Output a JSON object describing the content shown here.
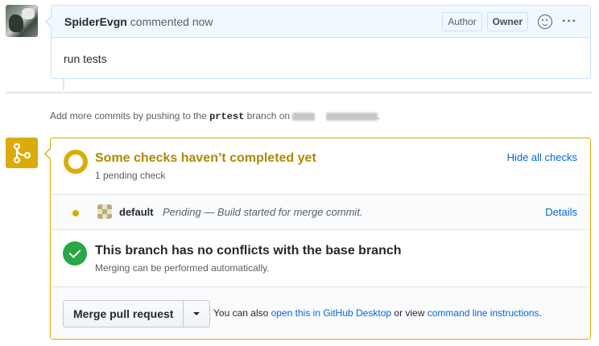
{
  "comment": {
    "author": "SpiderEvgn",
    "meta": "commented now",
    "badges": [
      "Author",
      "Owner"
    ],
    "body": "run tests"
  },
  "hint": {
    "prefix": "Add more commits by pushing to the",
    "branch": "prtest",
    "middle": "branch on",
    "suffix": "."
  },
  "checks": {
    "title": "Some checks haven’t completed yet",
    "subtitle": "1 pending check",
    "toggle_label": "Hide all checks",
    "items": [
      {
        "name": "default",
        "description": "Pending — Build started for merge commit.",
        "link": "Details",
        "status_color": "#dbab09"
      }
    ]
  },
  "conflicts": {
    "title": "This branch has no conflicts with the base branch",
    "subtitle": "Merging can be performed automatically."
  },
  "merge": {
    "button_label": "Merge pull request",
    "alt_prefix": "You can also",
    "alt_link1": "open this in GitHub Desktop",
    "alt_middle": "or view",
    "alt_link2": "command line instructions",
    "alt_suffix": "."
  },
  "colors": {
    "pending": "#dbab09",
    "success": "#28a745",
    "link": "#0366d6"
  }
}
